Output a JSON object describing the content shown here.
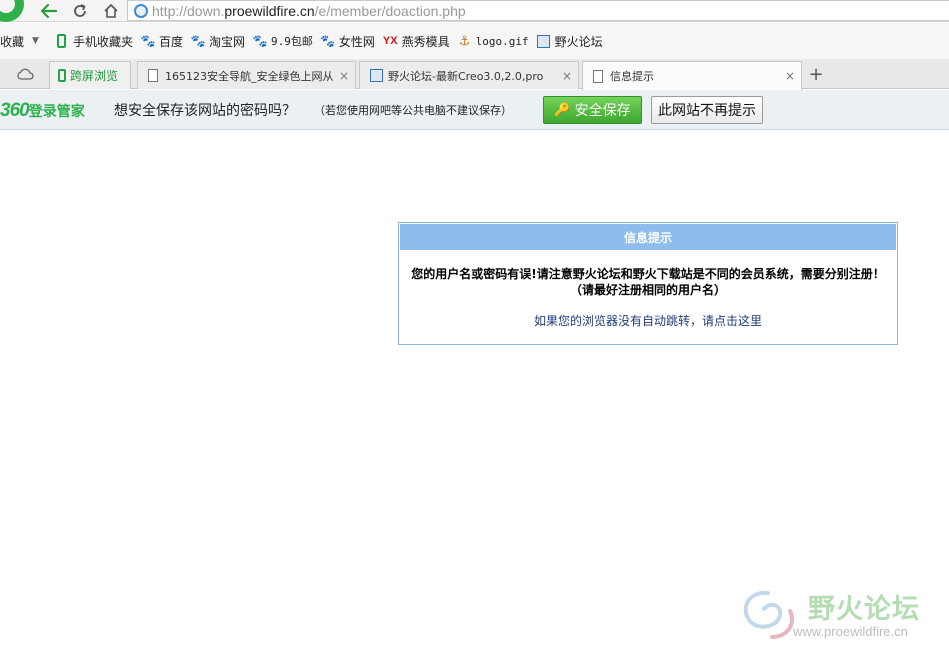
{
  "browser": {
    "address": {
      "url_prefix": "http://down.",
      "url_host": "proewildfire.cn",
      "url_path": "/e/member/doaction.php"
    }
  },
  "bookmarks": {
    "favorites_label": "收藏",
    "items": [
      {
        "label": "手机收藏夹",
        "icon": "phone-icon"
      },
      {
        "label": "百度",
        "icon": "paw-icon"
      },
      {
        "label": "淘宝网",
        "icon": "paw-icon"
      },
      {
        "label": "9.9包邮",
        "icon": "paw-icon"
      },
      {
        "label": "女性网",
        "icon": "paw-icon"
      },
      {
        "label": "燕秀模具",
        "icon": "yx-icon",
        "icon_text": "YX"
      },
      {
        "label": "logo.gif",
        "icon": "anchor-icon"
      },
      {
        "label": "野火论坛",
        "icon": "forum-icon"
      }
    ]
  },
  "tabs": {
    "cross_screen_label": "跨屏浏览",
    "items": [
      {
        "title": "165123安全导航_安全绿色上网从"
      },
      {
        "title": "野火论坛-最新Creo3.0,2.0,pro"
      },
      {
        "title": "信息提示",
        "active": true
      }
    ],
    "close_glyph": "×",
    "new_tab_glyph": "+"
  },
  "password_bar": {
    "brand_number": "360",
    "brand_text": "登录管家",
    "question": "想安全保存该网站的密码吗？",
    "note": "（若您使用网吧等公共电脑不建议保存）",
    "save_label": "安全保存",
    "never_label": "此网站不再提示"
  },
  "message": {
    "heading": "信息提示",
    "body": "您的用户名或密码有误!请注意野火论坛和野火下载站是不同的会员系统，需要分别注册！（请最好注册相同的用户名）",
    "link": "如果您的浏览器没有自动跳转，请点击这里"
  },
  "watermark": {
    "name": "野火论坛",
    "url": "www.proewildfire.cn"
  },
  "colors": {
    "accent_green": "#2eb04d",
    "message_header": "#8ebcec",
    "link": "#1f3c78"
  }
}
